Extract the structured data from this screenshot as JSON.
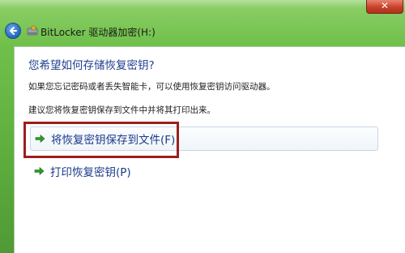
{
  "window": {
    "title": "BitLocker 驱动器加密(H:)",
    "close_glyph": "✕"
  },
  "content": {
    "heading": "您希望如何存储恢复密钥?",
    "para1": "如果您忘记密码或者丢失智能卡，可以使用恢复密钥访问驱动器。",
    "para2": "建议您将恢复密钥保存到文件中并将其打印出来。"
  },
  "options": [
    {
      "label": "将恢复密钥保存到文件(F)",
      "icon": "green-arrow-icon"
    },
    {
      "label": "打印恢复密钥(P)",
      "icon": "green-arrow-icon"
    }
  ],
  "colors": {
    "window_glass": "#6fc04a",
    "heading_text": "#1f3f8f",
    "link_text": "#1b3a8a",
    "annotation_border": "#9b1f1f",
    "arrow_green": "#2e9a2a"
  }
}
